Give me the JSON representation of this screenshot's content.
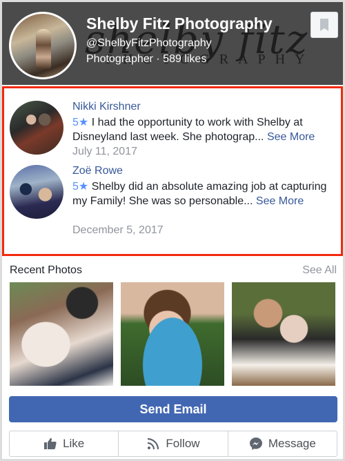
{
  "header": {
    "page_name": "Shelby Fitz Photography",
    "handle": "@ShelbyFitzPhotography",
    "meta": "Photographer · 589 likes",
    "cover_script": "shelby fitz",
    "cover_caps": "PHOTOGRAPHY",
    "bookmark_icon": "bookmark-icon"
  },
  "reviews": [
    {
      "name": "Nikki Kirshner",
      "rating": "5★",
      "text": " I had the opportunity to work with Shelby at Disneyland last week. She photograp... ",
      "see_more": "See More",
      "date": "July 11, 2017"
    },
    {
      "name": "Zoë Rowe",
      "rating": "5★",
      "text": " Shelby did an absolute amazing job at capturing my Family! She was so personable... ",
      "see_more": "See More",
      "date": "December 5, 2017"
    }
  ],
  "recent_photos": {
    "title": "Recent Photos",
    "see_all": "See All",
    "photos": [
      "wedding-couple-photo",
      "child-blue-blanket-photo",
      "wedding-couple-garden-photo"
    ]
  },
  "actions": {
    "send_email": "Send Email",
    "like": "Like",
    "follow": "Follow",
    "message": "Message"
  },
  "colors": {
    "brand": "#4267b2",
    "link": "#365899",
    "star": "#5890ff",
    "highlight_border": "#f2290c"
  }
}
